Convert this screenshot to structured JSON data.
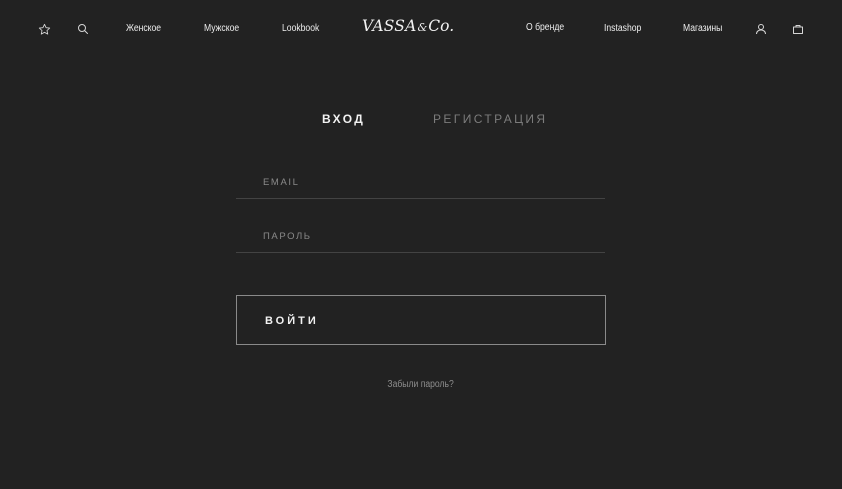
{
  "header": {
    "icons": {
      "favorites": "star-icon",
      "search": "search-icon",
      "account": "user-icon",
      "cart": "bag-icon"
    },
    "nav_left": [
      "Женское",
      "Мужское",
      "Lookbook"
    ],
    "logo": {
      "main": "VASSA",
      "amp": "&",
      "co": "Co."
    },
    "nav_right": [
      "О бренде",
      "Instashop",
      "Магазины"
    ]
  },
  "tabs": [
    {
      "label": "ВХОД",
      "active": true
    },
    {
      "label": "РЕГИСТРАЦИЯ",
      "active": false
    }
  ],
  "form": {
    "email": {
      "placeholder": "EMAIL",
      "value": ""
    },
    "password": {
      "placeholder": "ПАРОЛЬ",
      "value": ""
    },
    "submit_label": "ВОЙТИ",
    "forgot_label": "Забыли пароль?"
  },
  "colors": {
    "background": "#222222",
    "text": "#f2f2f2",
    "muted": "#7c7c7c",
    "field_line": "#434343",
    "button_border": "#8a8a8a"
  }
}
